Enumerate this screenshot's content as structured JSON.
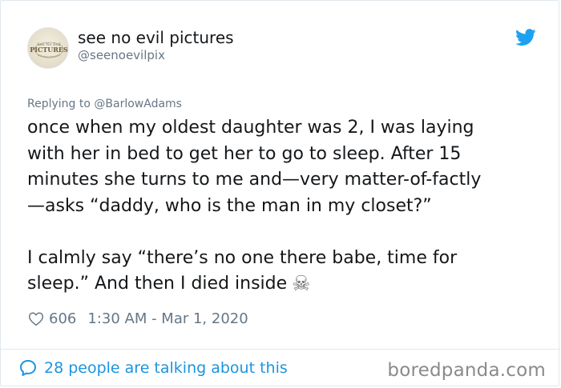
{
  "author": {
    "display_name": "see no evil pictures",
    "handle": "@seenoevilpix",
    "avatar_text": "See No Evil PICTURES"
  },
  "brand_icon": "twitter-bird-icon",
  "reply": {
    "prefix": "Replying to",
    "to": "@BarlowAdams"
  },
  "tweet": {
    "lines_p1": [
      "once when my oldest daughter was 2, I was laying",
      "with her in bed to get her to go to sleep. After 15",
      "minutes she turns to me and—very matter-of-factly",
      "—asks “daddy, who is the man in my closet?”"
    ],
    "lines_p2": [
      "I calmly say “there’s no one there babe, time for",
      "sleep.” And then I died inside"
    ],
    "emoji": "☠"
  },
  "meta": {
    "likes": "606",
    "timestamp": "1:30 AM - Mar 1, 2020"
  },
  "footer": {
    "conversation_label": "28 people are talking about this"
  },
  "watermark": "boredpanda.com",
  "colors": {
    "twitter_blue": "#1da1f2",
    "link_blue": "#1b95e0",
    "muted_gray": "#657786",
    "text": "#14171a",
    "border": "#e1e8ed"
  }
}
